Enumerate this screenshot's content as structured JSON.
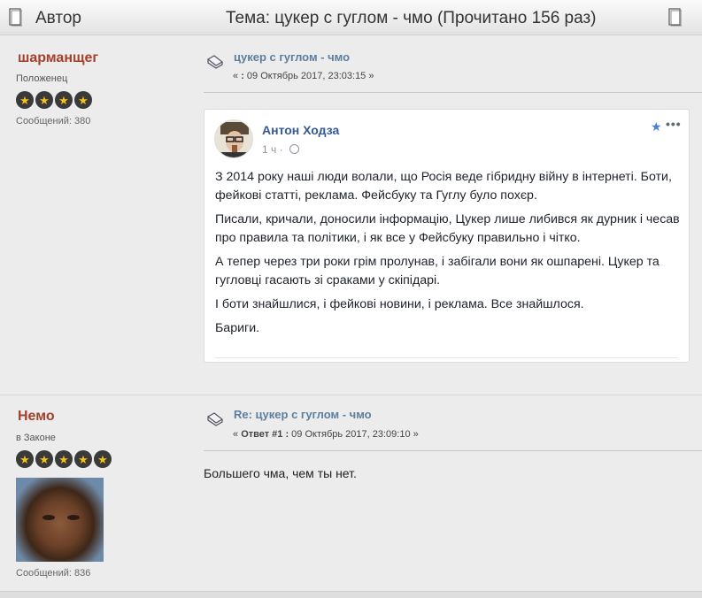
{
  "header": {
    "author_label": "Автор",
    "topic_label": "Тема: цукер с гуглом - чмо  (Прочитано 156 раз)"
  },
  "posts": [
    {
      "poster": {
        "name": "шарманщег",
        "group": "Положенец",
        "stars": 4,
        "post_count": "Сообщений: 380"
      },
      "subject": "цукер с гуглом - чмо",
      "date_prefix": "« ",
      "date_bold": ":",
      "date_text": " 09 Октябрь 2017, 23:03:15 »",
      "embed": {
        "author": "Антон Ходза",
        "time": "1 ч ·",
        "paragraphs": [
          "З 2014 року наші люди волали, що Росія веде гібридну війну в інтернеті. Боти, фейкові статті, реклама. Фейсбуку та Гуглу було похєр.",
          "Писали, кричали, доносили інформацію, Цукер лише либився як дурник і чесав про правила та політики, і як все у Фейсбуку правильно і чітко.",
          "А тепер через три роки грім пролунав, і забігали вони як ошпарені. Цукер та гугловці гасають зі сраками у скіпідарі.",
          "І боти знайшлися, і фейкові новини, і реклама. Все знайшлося.",
          "Бариги."
        ]
      }
    },
    {
      "poster": {
        "name": "Немо",
        "group": "в Законе",
        "stars": 5,
        "post_count": "Сообщений: 836"
      },
      "subject": "Re: цукер с гуглом - чмо",
      "date_prefix": "« ",
      "date_bold": "Ответ #1 :",
      "date_text": " 09 Октябрь 2017, 23:09:10 »",
      "body": "Большего чма, чем ты нет."
    }
  ],
  "colors": {
    "poster_name": "#a33f2a",
    "subject_link": "#5b7e9e",
    "fb_name": "#365899",
    "star_fill": "#f2c21b"
  },
  "icons": {
    "header_left": "topic-icon",
    "header_right": "document-icon",
    "post": "post-envelope-icon",
    "embed_star": "star-icon",
    "embed_more": "more-icon",
    "embed_privacy": "globe-icon"
  }
}
